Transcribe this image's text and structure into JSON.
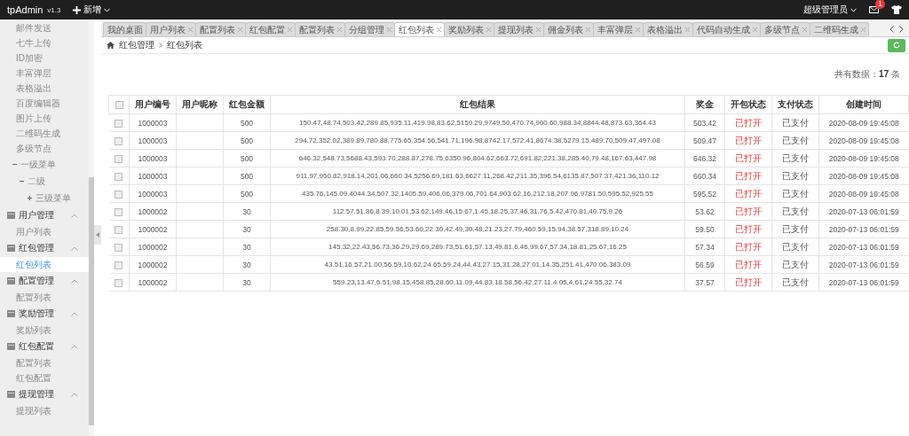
{
  "topbar": {
    "brand": "tpAdmin",
    "version": "v1.3",
    "add_menu": "新增",
    "user": "超级管理员",
    "mail_badge": "1"
  },
  "sidebar": {
    "items": [
      {
        "kind": "link",
        "label": "邮件发送",
        "selected": false
      },
      {
        "kind": "link",
        "label": "七牛上传",
        "selected": false
      },
      {
        "kind": "link",
        "label": "ID加密",
        "selected": false
      },
      {
        "kind": "link",
        "label": "丰富弹层",
        "selected": false
      },
      {
        "kind": "link",
        "label": "表格溢出",
        "selected": false
      },
      {
        "kind": "link",
        "label": "百度编辑器",
        "selected": false
      },
      {
        "kind": "link",
        "label": "图片上传",
        "selected": false
      },
      {
        "kind": "link",
        "label": "二维码生成",
        "selected": false
      },
      {
        "kind": "link",
        "label": "多级节点",
        "selected": false
      },
      {
        "kind": "tree",
        "label": "一级菜单",
        "expanded": true,
        "children": [
          {
            "label": "二级",
            "expanded": true,
            "children": [
              {
                "label": "三级菜单",
                "expanded": false
              }
            ]
          }
        ]
      },
      {
        "kind": "group",
        "label": "用户管理",
        "expanded": true
      },
      {
        "kind": "sub",
        "label": "用户列表",
        "selected": false
      },
      {
        "kind": "group",
        "label": "红包管理",
        "expanded": true
      },
      {
        "kind": "sub",
        "label": "红包列表",
        "selected": true
      },
      {
        "kind": "group",
        "label": "配置管理",
        "expanded": true
      },
      {
        "kind": "sub",
        "label": "配置列表",
        "selected": false
      },
      {
        "kind": "group",
        "label": "奖励管理",
        "expanded": true
      },
      {
        "kind": "sub",
        "label": "奖励列表",
        "selected": false
      },
      {
        "kind": "group",
        "label": "红包配置",
        "expanded": true
      },
      {
        "kind": "sub",
        "label": "配置列表",
        "selected": false
      },
      {
        "kind": "sub",
        "label": "红包配置",
        "selected": false
      },
      {
        "kind": "group",
        "label": "提现管理",
        "expanded": true
      },
      {
        "kind": "sub",
        "label": "提现列表",
        "selected": false
      }
    ]
  },
  "tabs": [
    {
      "label": "我的桌面",
      "selected": false,
      "closable": false
    },
    {
      "label": "用户列表",
      "selected": false,
      "closable": true
    },
    {
      "label": "配置列表",
      "selected": false,
      "closable": true
    },
    {
      "label": "红包配置",
      "selected": false,
      "closable": true
    },
    {
      "label": "配置列表",
      "selected": false,
      "closable": true
    },
    {
      "label": "分组管理",
      "selected": false,
      "closable": true
    },
    {
      "label": "红包列表",
      "selected": true,
      "closable": true
    },
    {
      "label": "奖励列表",
      "selected": false,
      "closable": true
    },
    {
      "label": "提现列表",
      "selected": false,
      "closable": true
    },
    {
      "label": "佣金列表",
      "selected": false,
      "closable": true
    },
    {
      "label": "丰富弹层",
      "selected": false,
      "closable": true
    },
    {
      "label": "表格溢出",
      "selected": false,
      "closable": true
    },
    {
      "label": "代码自动生成",
      "selected": false,
      "closable": true
    },
    {
      "label": "多级节点",
      "selected": false,
      "closable": true
    },
    {
      "label": "二维码生成",
      "selected": false,
      "closable": true
    }
  ],
  "breadcrumb": [
    "红包管理",
    "红包列表"
  ],
  "total": {
    "label": "共有数据：",
    "count": "17",
    "unit": "条"
  },
  "table": {
    "header_checked": false,
    "columns": [
      "用户编号",
      "用户昵称",
      "红包金额",
      "红包结果",
      "奖金",
      "开包状态",
      "支付状态",
      "创建时间"
    ],
    "rows": [
      {
        "checked": false,
        "user_id": "1000003",
        "amount": "500",
        "result": "150.47,48.74,503.42,289.85,935.11,419.98,83.62,5159.29,9749.50,470.74,900.60,988.34,8844.48,873.63,364.43",
        "bonus": "503.42",
        "open_status": "已打开",
        "pay_status": "已支付",
        "created": "2020-08-09 19:45:08"
      },
      {
        "checked": false,
        "user_id": "1000003",
        "amount": "500",
        "result": "294.72,352.02,389.89,780.88,775.65,354.56,541.71,196.98,8742.17,572.41,8674.38,5279.15,489.70,509.47,497.08",
        "bonus": "509.47",
        "open_status": "已打开",
        "pay_status": "已支付",
        "created": "2020-08-09 19:45:08"
      },
      {
        "checked": false,
        "user_id": "1000003",
        "amount": "500",
        "result": "646.32,548.73,5688.43,593.70,288.87,278.75,6350.96,804.62,663.72,691.82,221.38,285.40,79.48,167.63,447.98",
        "bonus": "646.32",
        "open_status": "已打开",
        "pay_status": "已支付",
        "created": "2020-08-09 19:45:08"
      },
      {
        "checked": false,
        "user_id": "1000003",
        "amount": "500",
        "result": "911.97,950.82,918.14,201.06,660.34,5256.69,181.63,6627.11,268.42,211.35,396.54,6135.87,507.37,421.36,110.12",
        "bonus": "660.34",
        "open_status": "已打开",
        "pay_status": "已支付",
        "created": "2020-08-09 19:45:08"
      },
      {
        "checked": false,
        "user_id": "1000003",
        "amount": "500",
        "result": "435.76,145.09,4044.34,507.32,1405.59,406.06,379.06,701.64,903.62,16,212.18,207.96,9781.50,595.52,925.55",
        "bonus": "595.52",
        "open_status": "已打开",
        "pay_status": "已支付",
        "created": "2020-08-09 19:45:08"
      },
      {
        "checked": false,
        "user_id": "1000002",
        "amount": "30",
        "result": "112.57,51.86,8.39,10.01,53.62,149.46,15.67,1.45,18.25,37.46,31.76,5.42,470.81,40.75,9.26",
        "bonus": "53.62",
        "open_status": "已打开",
        "pay_status": "已支付",
        "created": "2020-07-13 06:01:59"
      },
      {
        "checked": false,
        "user_id": "1000002",
        "amount": "30",
        "result": "258.30,8.99,22.85,59.56,53.60,22.30,42.49,30.48,21.23,27.79,460.59,15.94,38.57,318.89,10.24",
        "bonus": "59.50",
        "open_status": "已打开",
        "pay_status": "已支付",
        "created": "2020-07-13 06:01:59"
      },
      {
        "checked": false,
        "user_id": "1000002",
        "amount": "30",
        "result": "145.32,22.43,56.73,36.29,29.69,289.73,51.61,57.13,49.81,6.46,99.67,57.34,18.81,25.67,16.25",
        "bonus": "57.34",
        "open_status": "已打开",
        "pay_status": "已支付",
        "created": "2020-07-13 06:01:59"
      },
      {
        "checked": false,
        "user_id": "1000002",
        "amount": "30",
        "result": "43.51,16.57,21.00,56.59,10.62,24.65,59.24,44.43,27.15,31.28,27.01,14.35,251.41,470.06,383.09",
        "bonus": "56.59",
        "open_status": "已打开",
        "pay_status": "已支付",
        "created": "2020-07-13 06:01:59"
      },
      {
        "checked": false,
        "user_id": "1000002",
        "amount": "30",
        "result": "559.23,13.47,6.51,98.15,458.85,28.60,11.09,44.83,18.58,56.42,27.11,4.05,4.61,24.55,32.74",
        "bonus": "37.57",
        "open_status": "已打开",
        "pay_status": "已支付",
        "created": "2020-07-13 06:01:59"
      }
    ]
  }
}
